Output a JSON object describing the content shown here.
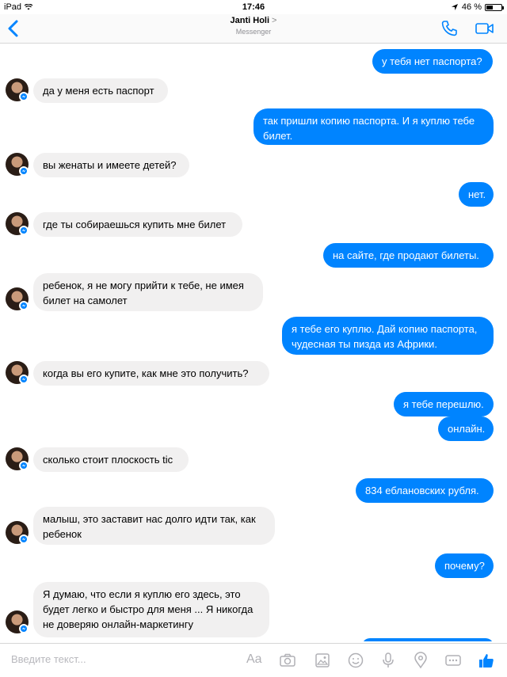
{
  "status": {
    "device": "iPad",
    "time": "17:46",
    "battery": "46 %",
    "battery_level": 0.46
  },
  "header": {
    "contact_name": "Janti Holi",
    "chevron": ">",
    "app": "Messenger"
  },
  "messages": [
    {
      "dir": "out",
      "text": "у тебя нет паспорта?"
    },
    {
      "dir": "in",
      "text": "да у меня есть паспорт"
    },
    {
      "dir": "out",
      "text": "так пришли копию паспорта. И я куплю тебе билет."
    },
    {
      "dir": "in",
      "text": "вы женаты и имеете детей?"
    },
    {
      "dir": "out",
      "text": "нет."
    },
    {
      "dir": "in",
      "text": "где ты собираешься купить мне билет"
    },
    {
      "dir": "out",
      "text": "на сайте, где продают билеты."
    },
    {
      "dir": "in",
      "text": "ребенок, я не могу прийти к тебе, не имея билет на самолет"
    },
    {
      "dir": "out",
      "text": "я тебе его куплю. Дай копию паспорта, чудесная ты пизда из Африки."
    },
    {
      "dir": "in",
      "text": "когда вы его купите, как мне это получить?"
    },
    {
      "dir": "out",
      "text": "я тебе перешлю."
    },
    {
      "dir": "out",
      "text": "онлайн."
    },
    {
      "dir": "in",
      "text": "сколько стоит плоскость tic"
    },
    {
      "dir": "out",
      "text": "834 еблановских рубля."
    },
    {
      "dir": "in",
      "text": "малыш, это заставит нас долго идти так, как ребенок"
    },
    {
      "dir": "out",
      "text": "почему?"
    },
    {
      "dir": "in",
      "text": "Я думаю, что если я куплю его здесь, это будет легко и быстро для меня ... Я никогда не доверяю онлайн-маркетингу"
    }
  ],
  "composer": {
    "placeholder": "Введите текст...",
    "font_label": "Aa",
    "icons": [
      "camera-icon",
      "gallery-icon",
      "emoji-icon",
      "microphone-icon",
      "location-icon",
      "more-icon",
      "like-icon"
    ]
  },
  "colors": {
    "accent": "#0084ff",
    "incoming_bubble": "#f1f0f0",
    "outgoing_bubble": "#0084ff"
  }
}
